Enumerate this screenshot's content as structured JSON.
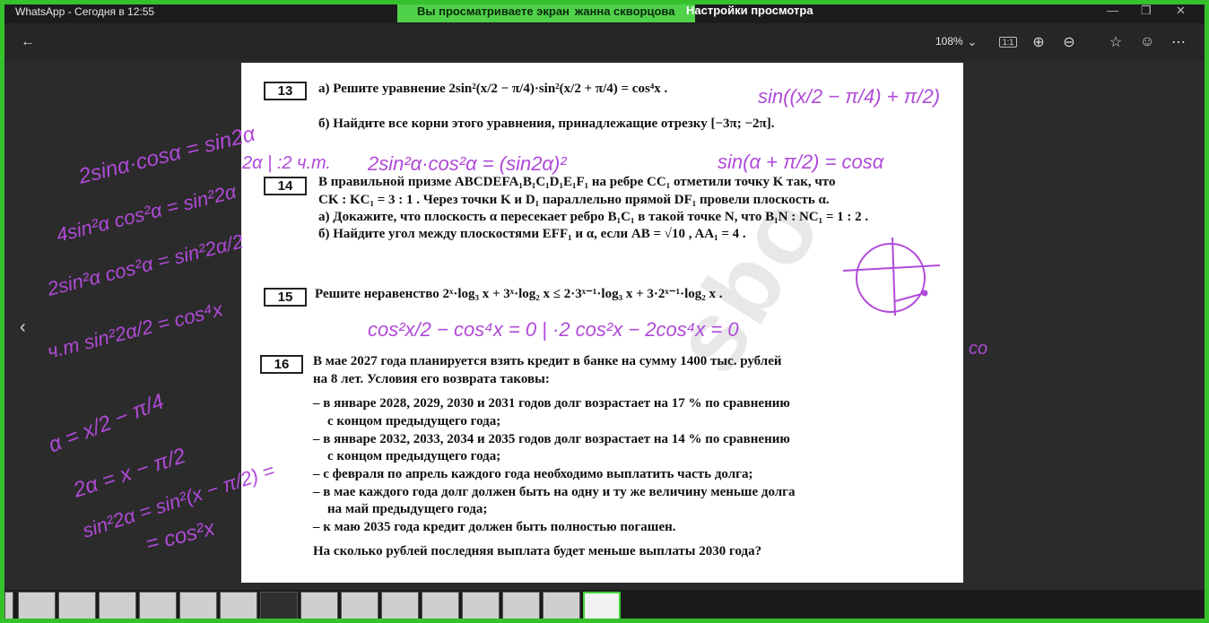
{
  "titlebar": {
    "title": "WhatsApp - Сегодня в 12:55",
    "minimize": "—",
    "restore": "❐",
    "close": "✕"
  },
  "share": {
    "viewing": "Вы просматриваете экран",
    "user": "жанна скворцова",
    "settings": "Настройки просмотра"
  },
  "toolbar": {
    "back": "←",
    "zoom": "108%",
    "zoom_chevron": "⌄",
    "fit": "1:1",
    "zoom_in": "⊕",
    "zoom_out": "⊖",
    "favorite": "☆",
    "feedback": "☺",
    "more": "⋯"
  },
  "nav": {
    "prev": "‹"
  },
  "doc": {
    "watermark": "sbo",
    "p13": {
      "num": "13",
      "a": "а) Решите уравнение 2sin²(x/2 − π/4)·sin²(x/2 + π/4) = cos⁴x .",
      "b": "б) Найдите все корни этого уравнения, принадлежащие отрезку [−3π; −2π]."
    },
    "p14": {
      "num": "14",
      "l1": "В правильной призме ABCDEFA₁B₁C₁D₁E₁F₁ на ребре CC₁ отметили точку K так, что",
      "l2": "CK : KC₁ = 3 : 1 . Через точки K и D₁ параллельно прямой DF₁ провели плоскость α.",
      "l3": "а) Докажите, что плоскость α пересекает ребро B₁C₁ в такой точке N, что B₁N : NC₁ = 1 : 2 .",
      "l4": "б) Найдите угол между плоскостями EFF₁ и α, если AB = √10 , AA₁ = 4 ."
    },
    "p15": {
      "num": "15",
      "l1": "Решите неравенство 2ˣ·log₃ x + 3ˣ·log₂ x ≤ 2·3ˣ⁻¹·log₃ x + 3·2ˣ⁻¹·log₂ x ."
    },
    "p16": {
      "num": "16",
      "l1": "В мае 2027 года планируется взять кредит в банке на сумму 1400 тыс. рублей",
      "l2": "на 8 лет. Условия его возврата таковы:",
      "l3": "– в январе 2028, 2029, 2030 и 2031 годов долг возрастает на 17 % по сравнению",
      "l4": "с концом предыдущего года;",
      "l5": "– в январе 2032, 2033, 2034 и 2035 годов долг возрастает на 14 % по сравнению",
      "l6": "с концом предыдущего года;",
      "l7": "– с февраля по апрель каждого года необходимо выплатить часть долга;",
      "l8": "– в мае каждого года долг должен быть на одну и ту же величину меньше долга",
      "l9": "на май предыдущего года;",
      "l10": "– к маю 2035 года кредит должен быть полностью погашен.",
      "l11": "На сколько рублей последняя выплата будет меньше выплаты 2030 года?"
    }
  },
  "ink": {
    "n1": "2sinα·cosα = sin2α",
    "n2": "4sin²α cos²α = sin²2α",
    "n3": "2sin²α cos²α = sin²2α/2",
    "n4": "ч.т  sin²2α/2 = cos⁴x",
    "n5": "α = x/2 − π/4",
    "n6": "2α = x − π/2",
    "n7": "sin²2α = sin²(x − π/2) =",
    "n8": "= cos²x",
    "n9": "sin((x/2 − π/4) + π/2)",
    "n10": "sin(α + π/2) = cosα",
    "n11": "2sin²α·cos²α = (sin2α)²",
    "n12": "cos²x/2 − cos⁴x = 0 | ·2   cos²x − 2cos⁴x = 0",
    "n13": "2α | :2  ч.т.",
    "n14": "co"
  },
  "colors": {
    "ink": "#b04ad8",
    "share_border": "#36c12c",
    "banner": "#4fd14a"
  }
}
